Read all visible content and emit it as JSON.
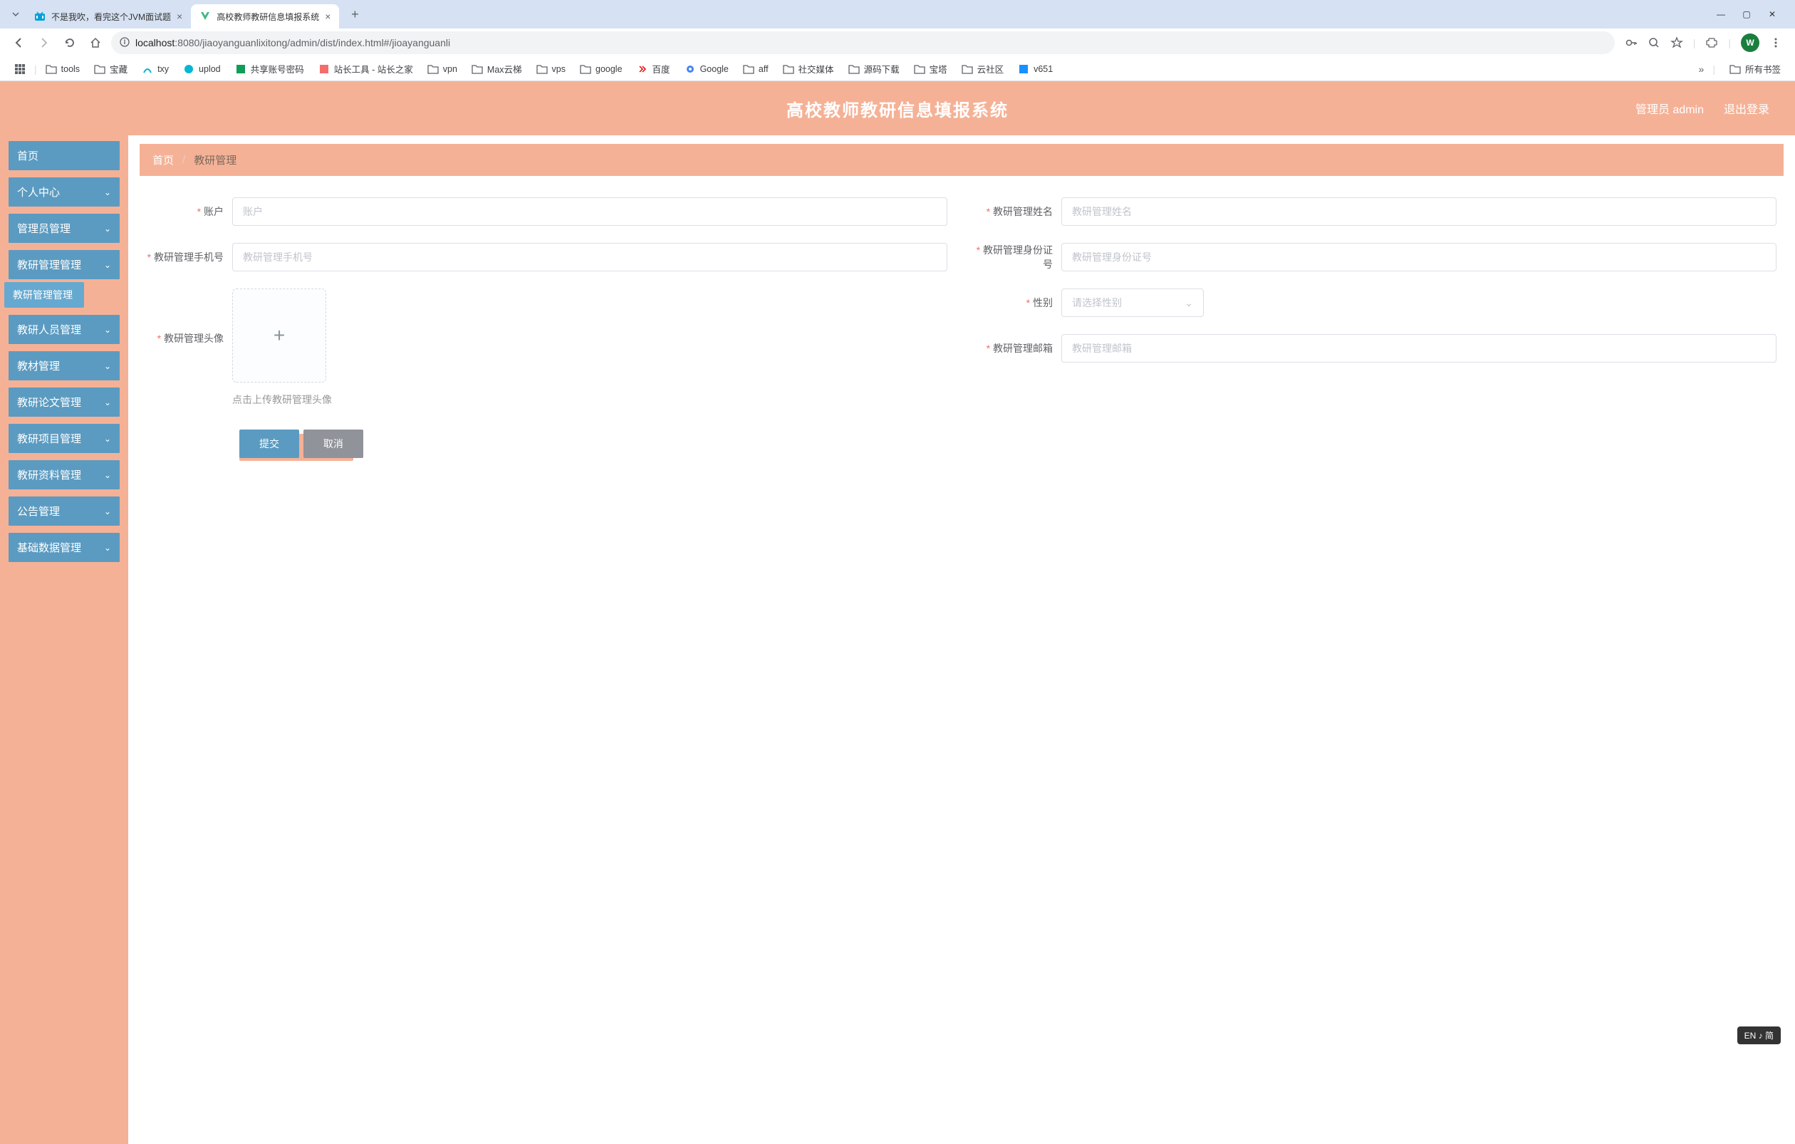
{
  "browser": {
    "tabs": [
      {
        "title": "不是我吹，看完这个JVM面试题",
        "icon": "bilibili"
      },
      {
        "title": "高校教师教研信息填报系统",
        "icon": "vue"
      }
    ],
    "url_host": "localhost",
    "url_port": ":8080",
    "url_path": "/jiaoyanguanlixitong/admin/dist/index.html#/jioayanguanli",
    "avatar_letter": "W",
    "bookmarks": [
      "tools",
      "宝藏",
      "txy",
      "uplod",
      "共享账号密码",
      "站长工具 - 站长之家",
      "vpn",
      "Max云梯",
      "vps",
      "google",
      "百度",
      "Google",
      "aff",
      "社交媒体",
      "源码下载",
      "宝塔",
      "云社区",
      "v651"
    ],
    "bookmarks_right": "所有书签"
  },
  "header": {
    "title": "高校教师教研信息填报系统",
    "user": "管理员 admin",
    "logout": "退出登录"
  },
  "sidebar": {
    "home": "首页",
    "items": [
      "个人中心",
      "管理员管理",
      "教研管理管理",
      "教研人员管理",
      "教材管理",
      "教研论文管理",
      "教研项目管理",
      "教研资料管理",
      "公告管理",
      "基础数据管理"
    ],
    "active_sub": "教研管理管理"
  },
  "breadcrumb": {
    "home": "首页",
    "current": "教研管理"
  },
  "form": {
    "account": {
      "label": "账户",
      "placeholder": "账户"
    },
    "name": {
      "label": "教研管理姓名",
      "placeholder": "教研管理姓名"
    },
    "phone": {
      "label": "教研管理手机号",
      "placeholder": "教研管理手机号"
    },
    "idcard": {
      "label": "教研管理身份证号",
      "placeholder": "教研管理身份证号"
    },
    "avatar": {
      "label": "教研管理头像",
      "tip": "点击上传教研管理头像"
    },
    "gender": {
      "label": "性别",
      "placeholder": "请选择性别"
    },
    "email": {
      "label": "教研管理邮箱",
      "placeholder": "教研管理邮箱"
    },
    "submit": "提交",
    "cancel": "取消"
  },
  "ime": "EN ♪ 简"
}
